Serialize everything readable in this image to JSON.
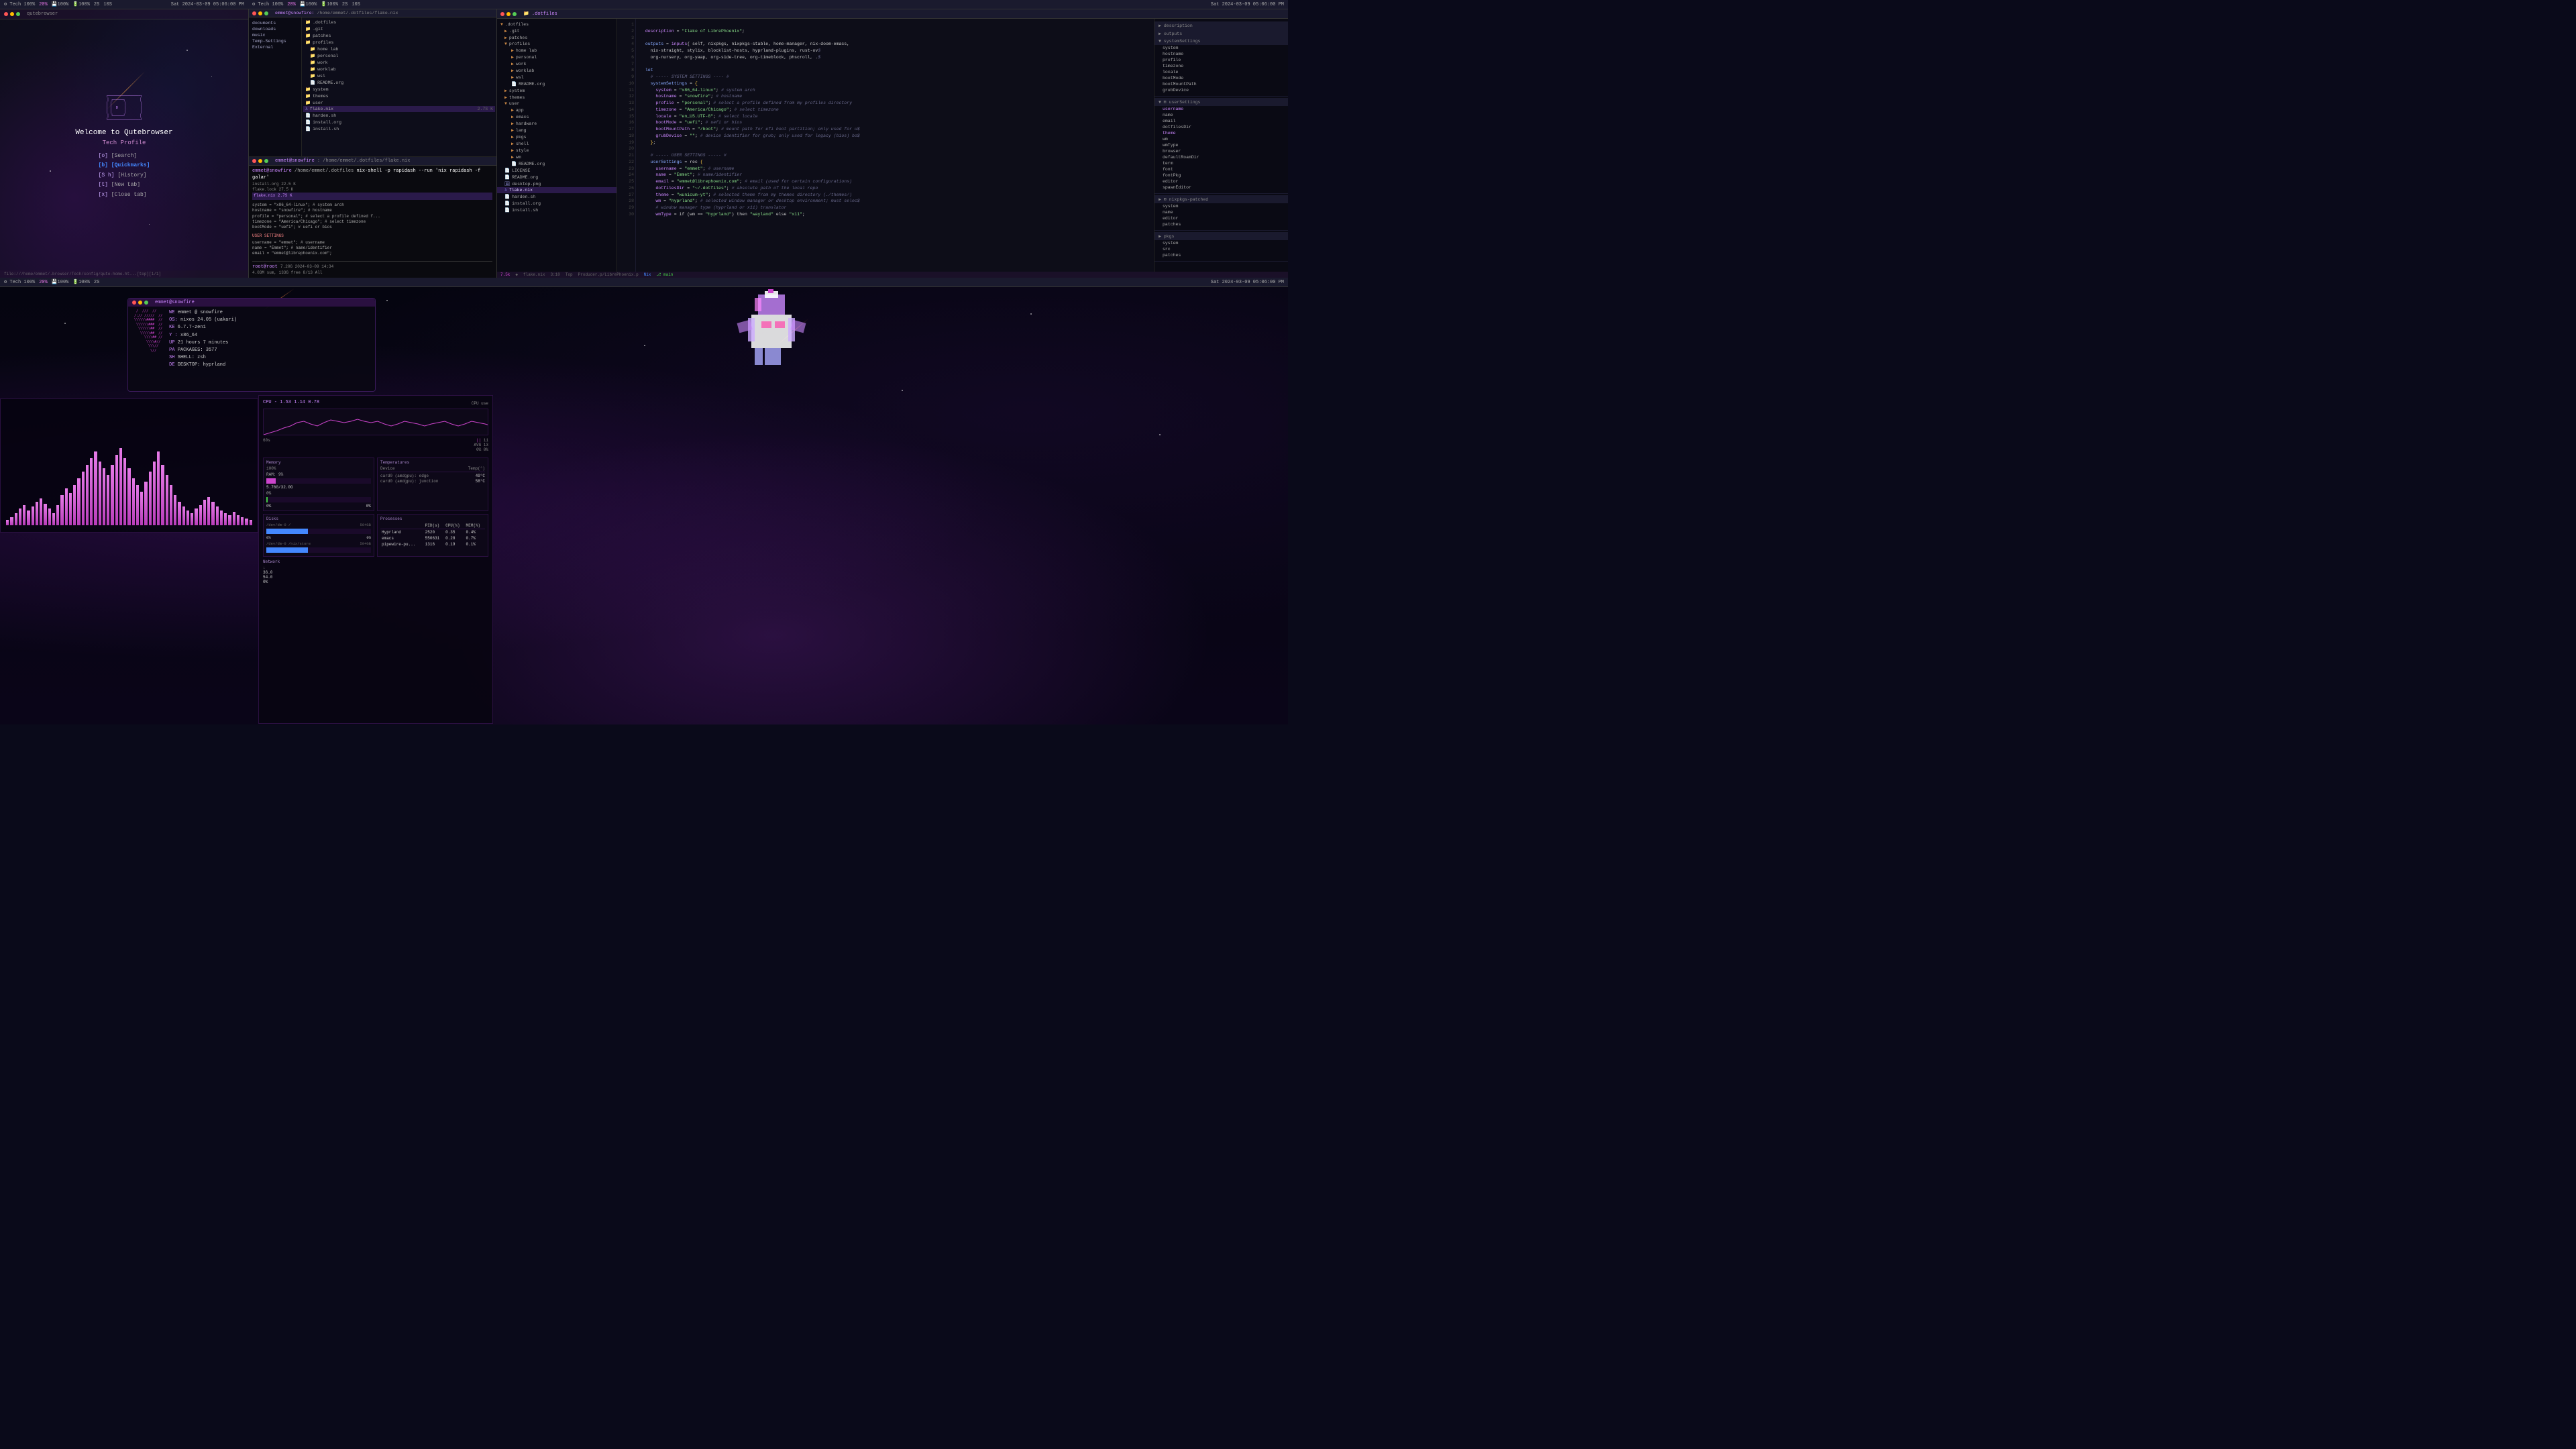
{
  "statusbar": {
    "left": {
      "workspace": "Tech 100%",
      "cpu": "20%",
      "mem": "100%",
      "battery": "100%",
      "windows": "2S",
      "layout": "10S"
    },
    "right": {
      "datetime": "Sat 2024-03-09 05:06:00 PM",
      "icons": [
        "net",
        "vol",
        "bat"
      ]
    }
  },
  "q1": {
    "title": "qutebrowser",
    "subtitle": "Welcome to Qutebrowser",
    "profile": "Tech Profile",
    "menu_items": [
      {
        "key": "[o]",
        "label": "[Search]",
        "active": false
      },
      {
        "key": "[b]",
        "label": "[Quickmarks]",
        "active": true
      },
      {
        "key": "[S h]",
        "label": "[History]",
        "active": false
      },
      {
        "key": "[t]",
        "label": "[New tab]",
        "active": false
      },
      {
        "key": "[x]",
        "label": "[Close tab]",
        "active": false
      }
    ],
    "statusbar": "file:///home/emmet/.browser/Tech/config/qute-home.ht...[top][1/1]"
  },
  "q2": {
    "file_manager": {
      "title": "emmet@snowfire: /home/emmet/.dotfiles/flake.nix",
      "path": "/home/emmet/.dotfiles",
      "sidebar_items": [
        "documents",
        "downloads",
        "music",
        "External",
        "..."
      ],
      "files": [
        {
          "name": ".dotfiles",
          "type": "folder",
          "size": ""
        },
        {
          "name": ".git",
          "type": "folder",
          "size": ""
        },
        {
          "name": "patches",
          "type": "folder",
          "size": ""
        },
        {
          "name": "profiles",
          "type": "folder",
          "size": ""
        },
        {
          "name": "home lab",
          "type": "folder",
          "size": ""
        },
        {
          "name": "personal",
          "type": "folder",
          "size": ""
        },
        {
          "name": "work",
          "type": "folder",
          "size": ""
        },
        {
          "name": "worklab",
          "type": "folder",
          "size": ""
        },
        {
          "name": "wsl",
          "type": "folder",
          "size": ""
        },
        {
          "name": "README.org",
          "type": "file",
          "size": ""
        },
        {
          "name": "system",
          "type": "folder",
          "size": ""
        },
        {
          "name": "themes",
          "type": "folder",
          "size": ""
        },
        {
          "name": "user",
          "type": "folder",
          "size": ""
        },
        {
          "name": "app",
          "type": "folder",
          "size": ""
        },
        {
          "name": "emacs",
          "type": "folder",
          "size": ""
        },
        {
          "name": "hardware",
          "type": "folder",
          "size": ""
        },
        {
          "name": "lang",
          "type": "folder",
          "size": ""
        },
        {
          "name": "pkgs",
          "type": "folder",
          "size": ""
        },
        {
          "name": "shell",
          "type": "folder",
          "size": ""
        },
        {
          "name": "style",
          "type": "folder",
          "size": ""
        },
        {
          "name": "wm",
          "type": "folder",
          "size": ""
        },
        {
          "name": "README.org",
          "type": "file",
          "size": ""
        },
        {
          "name": "LICENSE",
          "type": "file",
          "size": ""
        },
        {
          "name": "README.org",
          "type": "file",
          "size": ""
        },
        {
          "name": "desktop.png",
          "type": "file",
          "size": ""
        },
        {
          "name": "flake.nix",
          "type": "file",
          "size": "2.7S K",
          "selected": true
        },
        {
          "name": "harden.sh",
          "type": "file",
          "size": ""
        },
        {
          "name": "install.org",
          "type": "file",
          "size": ""
        },
        {
          "name": "install.sh",
          "type": "file",
          "size": ""
        }
      ]
    },
    "terminal": {
      "title": "root@root",
      "prompt": "root@root 7.20G 2024-03-09 14:34",
      "commands": [
        {
          "cmd": "nix-shell -p rapidash --run 'nix rapidash -f galar'",
          "output": ""
        },
        {
          "output": "4.03M sum, 133G free  8/13  All"
        }
      ]
    }
  },
  "q3": {
    "title": ".dotfiles",
    "file": "flake.nix",
    "code_lines": [
      {
        "n": 1,
        "text": "  description = \"Flake of LibrePhoenix\";"
      },
      {
        "n": 2,
        "text": ""
      },
      {
        "n": 3,
        "text": "  outputs = inputs{ self, nixpkgs, nixpkgs-stable, home-manager, nix-doom-emacs,"
      },
      {
        "n": 4,
        "text": "    nix-straight, stylix, blocklist-hosts, hyprland-plugins, rust-ov$"
      },
      {
        "n": 5,
        "text": "    org-nursery, org-yaap, org-side-tree, org-timeblock, phscroll, .$"
      },
      {
        "n": 6,
        "text": ""
      },
      {
        "n": 7,
        "text": "  let"
      },
      {
        "n": 8,
        "text": "    # ----- SYSTEM SETTINGS ---- #"
      },
      {
        "n": 9,
        "text": "    systemSettings = {"
      },
      {
        "n": 10,
        "text": "      system = \"x86_64-linux\"; # system arch"
      },
      {
        "n": 11,
        "text": "      hostname = \"snowfire\"; # hostname"
      },
      {
        "n": 12,
        "text": "      profile = \"personal\"; # select a profile defined from my profiles directory"
      },
      {
        "n": 13,
        "text": "      timezone = \"America/Chicago\"; # select timezone"
      },
      {
        "n": 14,
        "text": "      locale = \"en_US.UTF-8\"; # select locale"
      },
      {
        "n": 15,
        "text": "      bootMode = \"uefi\"; # uefi or bios"
      },
      {
        "n": 16,
        "text": "      bootMountPath = \"/boot\"; # mount path for efi boot partition; only used for u$"
      },
      {
        "n": 17,
        "text": "      grubDevice = \"\"; # device identifier for grub; only used for legacy (bios) bo$"
      },
      {
        "n": 18,
        "text": "    };"
      },
      {
        "n": 19,
        "text": ""
      },
      {
        "n": 20,
        "text": "    # ----- USER SETTINGS ----- #"
      },
      {
        "n": 21,
        "text": "    userSettings = rec {"
      },
      {
        "n": 22,
        "text": "      username = \"emmet\"; # username"
      },
      {
        "n": 23,
        "text": "      name = \"Emmet\"; # name/identifier"
      },
      {
        "n": 24,
        "text": "      email = \"emmet@librephoenix.com\"; # email (used for certain configurations)"
      },
      {
        "n": 25,
        "text": "      dotfilesDir = \"~/.dotfiles\"; # absolute path of the local repo"
      },
      {
        "n": 26,
        "text": "      theme = \"wunicum-yt\"; # selected theme from my themes directory (./themes/)"
      },
      {
        "n": 27,
        "text": "      wm = \"hyprland\"; # selected window manager or desktop environment; must selec$"
      },
      {
        "n": 28,
        "text": "      # window manager type (hyprland or x11) translator"
      },
      {
        "n": 29,
        "text": "      wmType = if (wm == \"hyprland\") then \"wayland\" else \"x11\";"
      }
    ],
    "right_panel": {
      "sections": [
        {
          "name": "description",
          "items": [
            "outputs",
            "systemSettings",
            "system",
            "hostname",
            "profile",
            "timezone",
            "locale",
            "bootMode",
            "bootMountPath",
            "grubDevice"
          ]
        },
        {
          "name": "userSettings",
          "items": [
            "username",
            "name",
            "email",
            "dotfilesDir",
            "theme",
            "wm",
            "wmType",
            "browser",
            "defaultRoamDir",
            "term",
            "font",
            "fontPkg",
            "editor",
            "spawnEditor"
          ]
        },
        {
          "name": "nixpkgs-patched",
          "items": [
            "system",
            "name",
            "editor",
            "patches"
          ]
        },
        {
          "name": "pkgs",
          "items": [
            "system",
            "src",
            "patches"
          ]
        }
      ]
    },
    "statusbar": {
      "file": "flake.nix",
      "position": "3:10",
      "top": "Top",
      "lang": "Nix",
      "branch": "main"
    }
  },
  "q4": {
    "fetch": {
      "title": "emmet@snowfire",
      "ascii_art": "neofetch-style",
      "info": {
        "WE": "emmet @ snowfire",
        "OS": "nixos 24.05 (uakari)",
        "KE": "6.7.7-zen1",
        "AR": "x86_64",
        "UP": "21 hours 7 minutes",
        "PA": "3577",
        "SH": "zsh",
        "DE": "hyprland"
      }
    },
    "sysmon": {
      "cpu_label": "CPU - 1.53 1.14 0.78",
      "cpu_percent": 11,
      "cpu_avg": 13,
      "cpu_ok": 0,
      "memory": {
        "label": "Memory",
        "ram_label": "RAM: 9%",
        "ram_used": "5.76G/32.0GB",
        "ram_percent": 9,
        "swap_percent": 0
      },
      "temps": {
        "label": "Temperatures",
        "entries": [
          {
            "device": "card0 (amdgpu): edge",
            "temp": "49°C"
          },
          {
            "device": "card0 (amdgpu): junction",
            "temp": "58°C"
          }
        ]
      },
      "disks": {
        "label": "Disks",
        "entries": [
          {
            "path": "/dev/dm-0 /",
            "size": "504GB"
          },
          {
            "path": "/dev/dm-0 /nix/store",
            "size": "504GB"
          }
        ]
      },
      "network": {
        "label": "Network",
        "down": "36.0",
        "up": "54.0",
        "idle": "0%"
      },
      "processes": {
        "label": "Processes",
        "headers": [
          "PID(s)",
          "CPU(%)",
          "MEM(%)"
        ],
        "entries": [
          {
            "name": "Hyprland",
            "pid": "2520",
            "cpu": "0.35",
            "mem": "0.4%"
          },
          {
            "name": "emacs",
            "pid": "550631",
            "cpu": "0.28",
            "mem": "0.7%"
          },
          {
            "name": "pipewire-pu...",
            "pid": "1316",
            "cpu": "0.19",
            "mem": "0.1%"
          }
        ]
      }
    },
    "visualizer": {
      "bars": [
        8,
        12,
        18,
        25,
        30,
        22,
        15,
        28,
        35,
        40,
        32,
        25,
        18,
        30,
        45,
        55,
        48,
        35,
        28,
        22,
        30,
        38,
        45,
        52,
        48,
        40,
        32,
        28,
        35,
        42,
        48,
        40,
        35,
        28,
        22,
        18,
        25,
        32,
        40,
        48,
        55,
        45,
        35,
        28,
        22,
        18,
        25,
        30,
        38,
        42,
        35,
        28,
        22,
        18,
        15,
        20,
        25,
        30,
        35,
        28,
        22,
        15,
        12,
        10,
        8
      ]
    }
  }
}
